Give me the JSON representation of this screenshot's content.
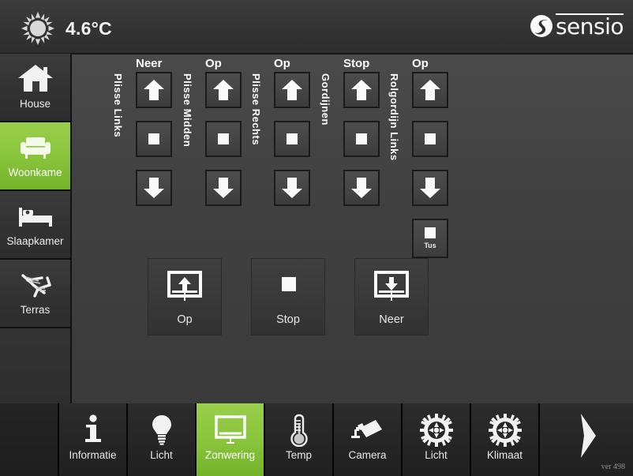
{
  "header": {
    "temperature": "4.6°C",
    "sun_icon": "sun-icon",
    "brand": "sensio",
    "brand_mark": "sensio-swirl-icon"
  },
  "sidebar": {
    "items": [
      {
        "label": "House",
        "icon": "house-icon",
        "active": false
      },
      {
        "label": "Woonkame",
        "icon": "armchair-icon",
        "active": true
      },
      {
        "label": "Slaapkamer",
        "icon": "bed-icon",
        "active": false
      },
      {
        "label": "Terras",
        "icon": "deckchair-icon",
        "active": false
      }
    ]
  },
  "main": {
    "columns": [
      {
        "title": "Neer",
        "vlabel": "Plisse Links",
        "up": "arrow-up-icon",
        "stop": "square-icon",
        "down": "arrow-down-icon",
        "has_tus": false
      },
      {
        "title": "Op",
        "vlabel": "Plisse Midden",
        "up": "arrow-up-icon",
        "stop": "square-icon",
        "down": "arrow-down-icon",
        "has_tus": false
      },
      {
        "title": "Op",
        "vlabel": "Plisse Rechts",
        "up": "arrow-up-icon",
        "stop": "square-icon",
        "down": "arrow-down-icon",
        "has_tus": false
      },
      {
        "title": "Stop",
        "vlabel": "Gordijnen",
        "up": "arrow-up-icon",
        "stop": "square-icon",
        "down": "arrow-down-icon",
        "has_tus": false
      },
      {
        "title": "Op",
        "vlabel": "Rolgordijn Links",
        "up": "arrow-up-icon",
        "stop": "square-icon",
        "down": "arrow-down-icon",
        "has_tus": true,
        "tus_label": "Tus"
      }
    ],
    "group_buttons": [
      {
        "label": "Op",
        "icon": "blind-up-icon"
      },
      {
        "label": "Stop",
        "icon": "square-icon"
      },
      {
        "label": "Neer",
        "icon": "blind-down-icon"
      }
    ]
  },
  "bottom_nav": {
    "items": [
      {
        "label": "Informatie",
        "icon": "info-icon",
        "active": false
      },
      {
        "label": "Licht",
        "icon": "lightbulb-icon",
        "active": false
      },
      {
        "label": "Zonwering",
        "icon": "blind-screen-icon",
        "active": true
      },
      {
        "label": "Temp",
        "icon": "thermometer-icon",
        "active": false
      },
      {
        "label": "Camera",
        "icon": "camera-icon",
        "active": false
      },
      {
        "label": "Licht",
        "icon": "gear-icon",
        "active": false
      },
      {
        "label": "Klimaat",
        "icon": "gear-icon",
        "active": false
      }
    ],
    "version": "ver 498",
    "next_icon": "chevron-right-icon"
  },
  "colors": {
    "accent_green": "#8cc63f",
    "panel_bg": "#414141",
    "chrome_bg": "#2e2e2e",
    "nav_bg": "#262626",
    "text": "#ededed"
  }
}
